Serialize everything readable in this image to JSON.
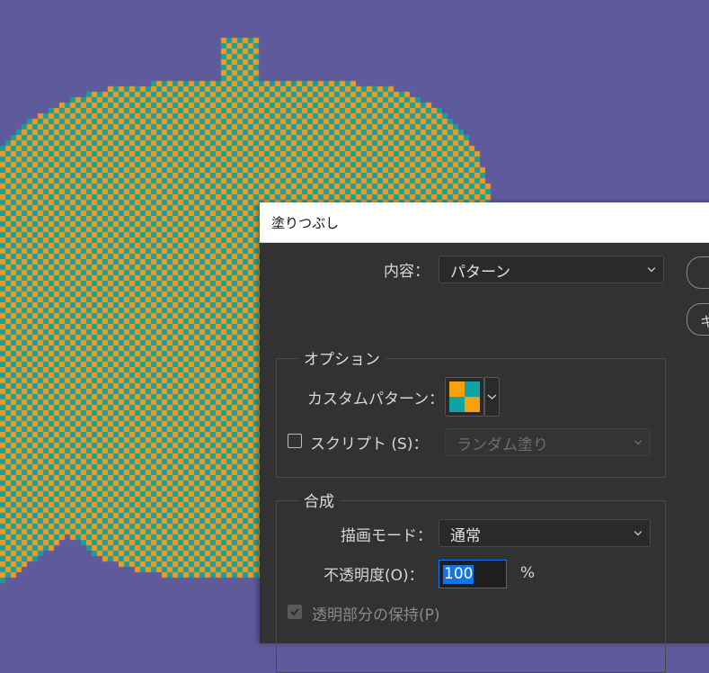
{
  "canvas": {
    "background_color": "#5f5a9c",
    "pattern_colors": [
      "#f19a22",
      "#1a9e9a"
    ],
    "shape": "pumpkin"
  },
  "dialog": {
    "title": "塗りつぶし",
    "contents": {
      "label": "内容：",
      "value": "パターン"
    },
    "options": {
      "title": "オプション",
      "custom_pattern_label": "カスタムパターン：",
      "pattern_colors": [
        "#f7a20c",
        "#0fa3a3"
      ],
      "script_label": "スクリプト (S)：",
      "script_checked": false,
      "script_value": "ランダム塗り"
    },
    "blending": {
      "title": "合成",
      "mode_label": "描画モード：",
      "mode_value": "通常",
      "opacity_label": "不透明度(O)：",
      "opacity_value": "100",
      "opacity_unit": "%",
      "preserve_label": "透明部分の保持(P)",
      "preserve_checked": true
    },
    "buttons": {
      "ok_label": "",
      "cancel_label": "キ"
    }
  }
}
